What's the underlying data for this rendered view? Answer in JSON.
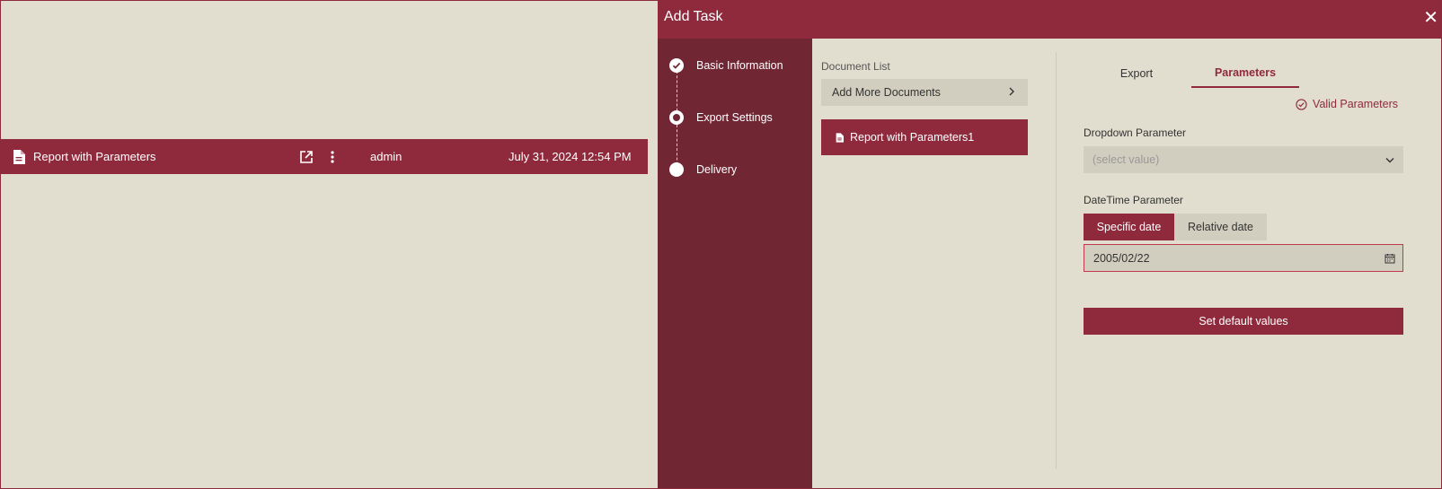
{
  "list_row": {
    "name": "Report with Parameters",
    "owner": "admin",
    "date": "July 31, 2024 12:54 PM",
    "icons": [
      "document-icon",
      "open-external-icon",
      "more-vert-icon"
    ]
  },
  "modal": {
    "title": "Add Task",
    "close_label": "✕",
    "steps": [
      {
        "label": "Basic Information",
        "state": "done"
      },
      {
        "label": "Export Settings",
        "state": "current"
      },
      {
        "label": "Delivery",
        "state": "pending"
      }
    ],
    "document_list": {
      "label": "Document List",
      "add_more": "Add More Documents",
      "items": [
        "Report with Parameters1"
      ]
    },
    "tabs": [
      "Export",
      "Parameters"
    ],
    "active_tab": "Parameters",
    "valid_label": "Valid Parameters",
    "dropdown_param": {
      "label": "Dropdown Parameter",
      "placeholder": "(select value)"
    },
    "datetime_param": {
      "label": "DateTime Parameter",
      "modes": [
        "Specific date",
        "Relative date"
      ],
      "active_mode": "Specific date",
      "value": "2005/02/22"
    },
    "default_button": "Set default values"
  },
  "colors": {
    "accent": "#8f2a3d",
    "stepper_bg": "#712634",
    "background": "#e1ddcf",
    "field_bg": "#d2cebf"
  }
}
